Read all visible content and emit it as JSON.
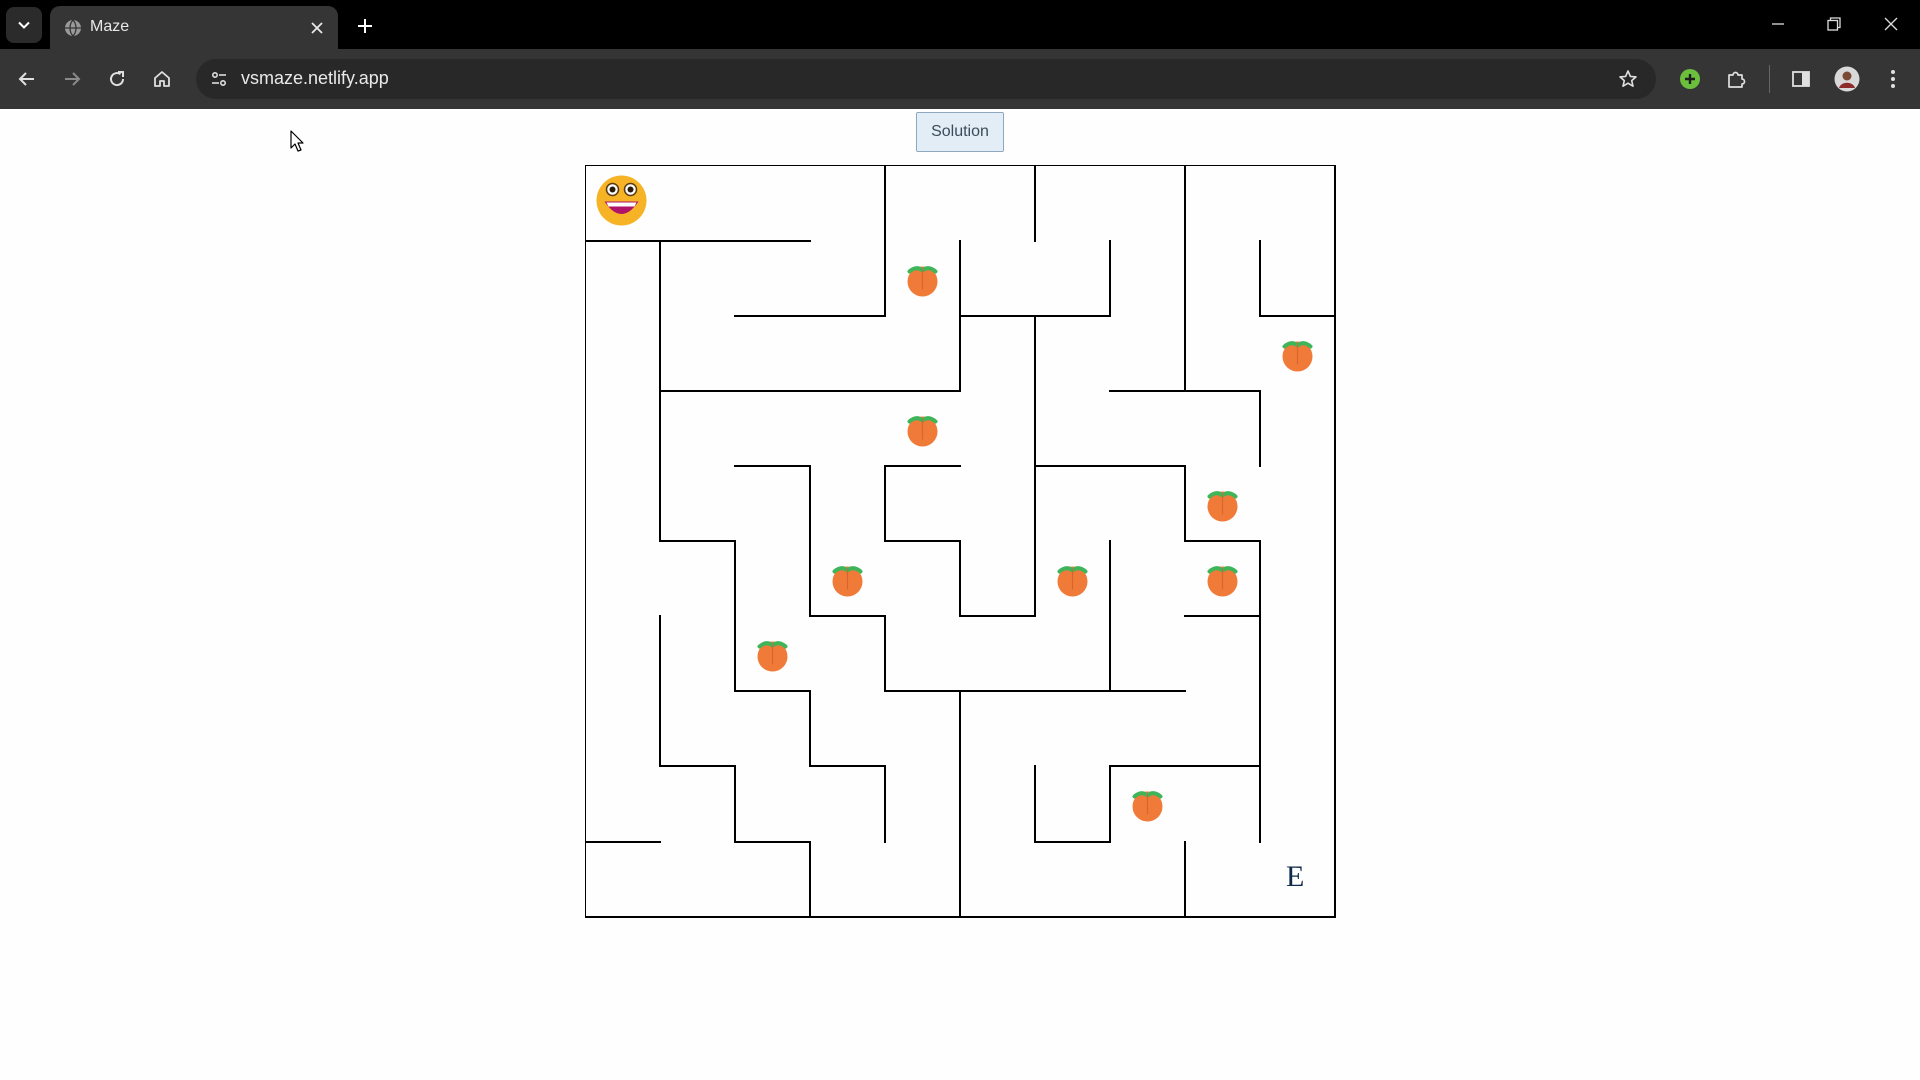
{
  "browser": {
    "tab": {
      "title": "Maze"
    },
    "address_bar": {
      "url": "vsmaze.netlify.app"
    }
  },
  "page": {
    "solution_button": {
      "label": "Solution"
    },
    "maze": {
      "grid": {
        "rows": 10,
        "cols": 10
      },
      "player": {
        "row": 0,
        "col": 0,
        "icon": "smiley-face-icon"
      },
      "exit": {
        "row": 9,
        "col": 9,
        "label": "E"
      },
      "peaches": [
        {
          "row": 1,
          "col": 4
        },
        {
          "row": 2,
          "col": 9
        },
        {
          "row": 3,
          "col": 4
        },
        {
          "row": 4,
          "col": 8
        },
        {
          "row": 5,
          "col": 3
        },
        {
          "row": 5,
          "col": 6
        },
        {
          "row": 5,
          "col": 8
        },
        {
          "row": 6,
          "col": 2
        },
        {
          "row": 8,
          "col": 7
        }
      ]
    }
  },
  "colors": {
    "wall": "#000000",
    "peach": "#f07a38",
    "leaf": "#3fb55a",
    "page_bg": "#fefefe"
  }
}
